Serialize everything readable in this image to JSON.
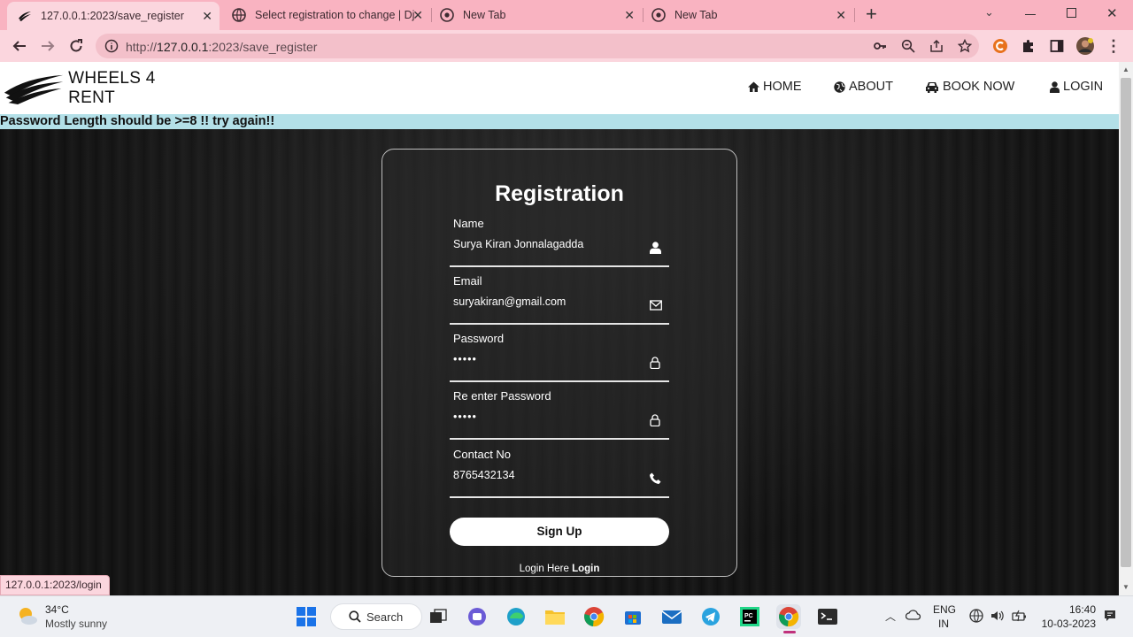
{
  "browser": {
    "tabs": [
      {
        "title": "127.0.0.1:2023/save_register",
        "active": true
      },
      {
        "title": "Select registration to change | Dj",
        "active": false
      },
      {
        "title": "New Tab",
        "active": false
      },
      {
        "title": "New Tab",
        "active": false
      }
    ],
    "new_tab_symbol": "+",
    "url_prefix": "http://",
    "url_host": "127.0.0.1",
    "url_rest": ":2023/save_register",
    "status_url": "127.0.0.1:2023/login"
  },
  "site": {
    "brand": "WHEELS 4 RENT",
    "nav": [
      {
        "label": "HOME",
        "icon": "home-icon"
      },
      {
        "label": "ABOUT",
        "icon": "globe-icon"
      },
      {
        "label": "BOOK NOW",
        "icon": "car-icon"
      },
      {
        "label": "LOGIN",
        "icon": "user-icon"
      }
    ],
    "alert": "Password Length should be >=8 !! try again!!"
  },
  "form": {
    "title": "Registration",
    "fields": [
      {
        "label": "Name",
        "value": "Surya Kiran Jonnalagadda",
        "icon": "user-icon"
      },
      {
        "label": "Email",
        "value": "suryakiran@gmail.com",
        "icon": "envelope-icon"
      },
      {
        "label": "Password",
        "value": "•••••",
        "icon": "lock-icon"
      },
      {
        "label": "Re enter Password",
        "value": "•••••",
        "icon": "lock-icon"
      },
      {
        "label": "Contact No",
        "value": "8765432134",
        "icon": "phone-icon"
      }
    ],
    "submit_label": "Sign Up",
    "login_prompt": "Login Here",
    "login_link": "Login"
  },
  "taskbar": {
    "weather_temp": "34°C",
    "weather_desc": "Mostly sunny",
    "search_label": "Search",
    "lang_top": "ENG",
    "lang_bottom": "IN",
    "time": "16:40",
    "date": "10-03-2023"
  },
  "colors": {
    "tab_strip": "#f9b3c1",
    "toolbar": "#fbd6de",
    "alert_bg": "#b3e0e8",
    "page_bg": "#141414"
  }
}
